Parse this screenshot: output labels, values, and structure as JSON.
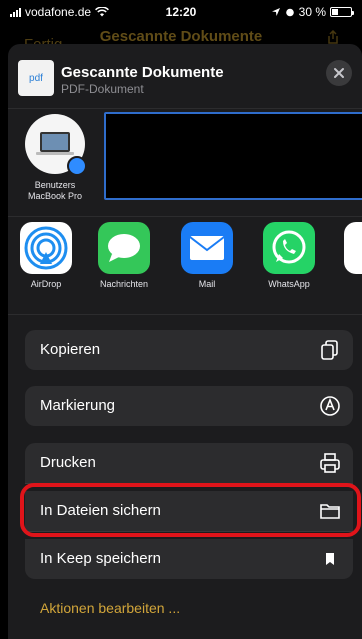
{
  "status_bar": {
    "carrier": "vodafone.de",
    "time": "12:20",
    "battery": "30 %",
    "battery_level": 0.3
  },
  "background_nav": {
    "done_label": "Fertig",
    "title": "Gescannte Dokumente"
  },
  "document": {
    "thumb_label": "pdf",
    "title": "Gescannte Dokumente",
    "subtitle": "PDF-Dokument"
  },
  "airdrop_device": {
    "label_line1": "Benutzers",
    "label_line2": "MacBook Pro"
  },
  "apps": [
    {
      "label": "AirDrop",
      "icon": "airdrop-icon",
      "color": "#1e8ef0"
    },
    {
      "label": "Nachrichten",
      "icon": "messages-icon",
      "color": "#34c759"
    },
    {
      "label": "Mail",
      "icon": "mail-icon",
      "color": "#1a7cf5"
    },
    {
      "label": "WhatsApp",
      "icon": "whatsapp-icon",
      "color": "#25d366"
    }
  ],
  "actions": [
    {
      "label": "Kopieren",
      "icon": "copy-icon"
    },
    {
      "label": "Markierung",
      "icon": "markup-icon"
    },
    {
      "label": "Drucken",
      "icon": "print-icon"
    },
    {
      "label": "In Dateien sichern",
      "icon": "folder-icon"
    },
    {
      "label": "In Keep speichern",
      "icon": "bookmark-icon"
    }
  ],
  "edit_actions_label": "Aktionen bearbeiten ...",
  "colors": {
    "sheet_bg": "#1c1c1e",
    "row_bg": "#2c2c2e",
    "highlight": "#e0141a",
    "accent": "#d1a53a"
  }
}
